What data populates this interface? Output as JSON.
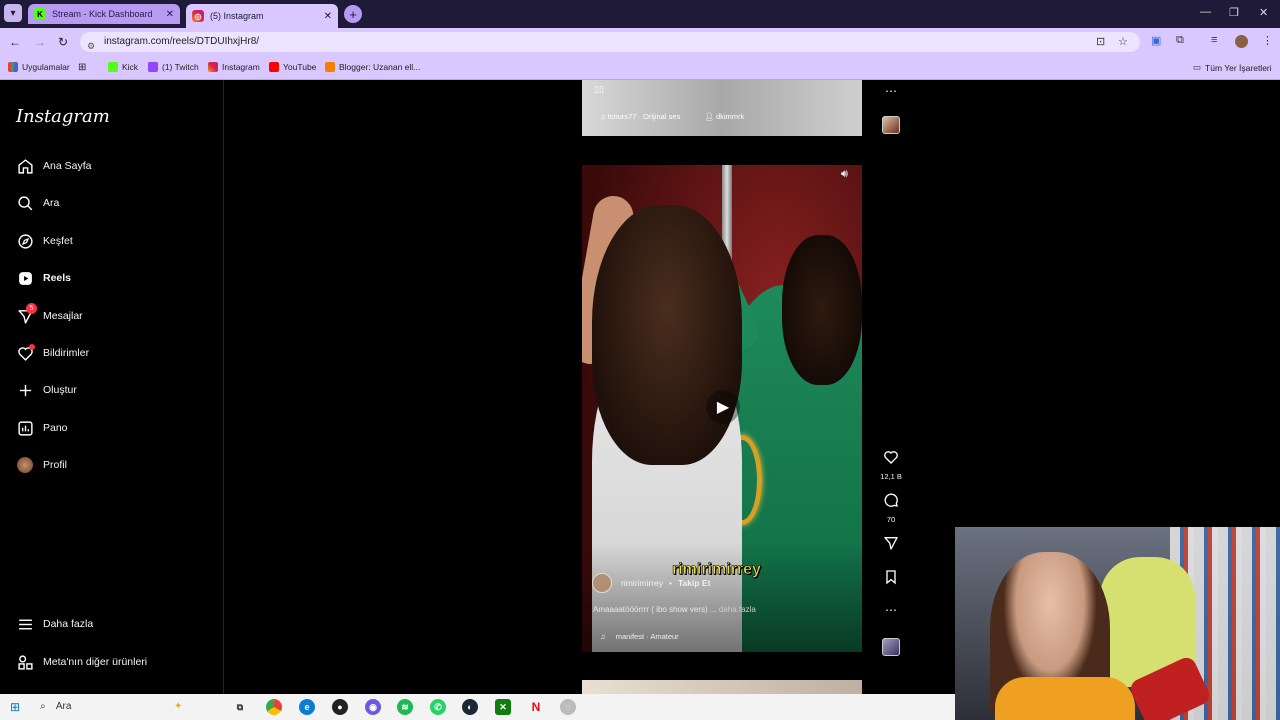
{
  "browser": {
    "tabs": [
      {
        "title": "Stream - Kick Dashboard",
        "favicon": "K",
        "active": false
      },
      {
        "title": "(5) Instagram",
        "favicon": "ig",
        "active": true
      }
    ],
    "new_tab": "+",
    "url": "instagram.com/reels/DTDUIhxjHr8/",
    "bookmarks": [
      {
        "label": "Uygulamalar",
        "icon": "apps-grid-icon"
      },
      {
        "label": "Kick",
        "icon": "kick-icon"
      },
      {
        "label": "(1) Twitch",
        "icon": "twitch-icon"
      },
      {
        "label": "Instagram",
        "icon": "instagram-icon"
      },
      {
        "label": "YouTube",
        "icon": "youtube-icon"
      },
      {
        "label": "Blogger: Uzanan ell...",
        "icon": "blogger-icon"
      }
    ],
    "all_bookmarks": "Tüm Yer İşaretleri"
  },
  "sidebar": {
    "logo": "Instagram",
    "items": [
      {
        "label": "Ana Sayfa",
        "icon": "home-icon",
        "bold": false
      },
      {
        "label": "Ara",
        "icon": "search-icon",
        "bold": false
      },
      {
        "label": "Keşfet",
        "icon": "compass-icon",
        "bold": false
      },
      {
        "label": "Reels",
        "icon": "reels-icon",
        "bold": true
      },
      {
        "label": "Mesajlar",
        "icon": "messenger-icon",
        "bold": false,
        "badge": "5"
      },
      {
        "label": "Bildirimler",
        "icon": "heart-icon",
        "bold": false
      },
      {
        "label": "Oluştur",
        "icon": "plus-icon",
        "bold": false
      },
      {
        "label": "Pano",
        "icon": "dashboard-icon",
        "bold": false
      },
      {
        "label": "Profil",
        "icon": "profile-avatar",
        "bold": false
      }
    ],
    "more": "Daha fazla",
    "meta": "Meta'nın diğer ürünleri"
  },
  "prev_reel": {
    "audio": "tsnurs77 · Orijinal ses",
    "tagged": "dkimmrk"
  },
  "reel": {
    "overlay_text": "rimirimirrey",
    "author": "rimirimirrey",
    "separator": "•",
    "follow": "Takip Et",
    "caption": "Amaaaatööörrrr ( ibo show vers) ...",
    "more": "daha fazla",
    "audio": "manifest · Amateur",
    "likes": "12,1 B",
    "comments": "70"
  },
  "taskbar": {
    "search_placeholder": "Ara"
  }
}
